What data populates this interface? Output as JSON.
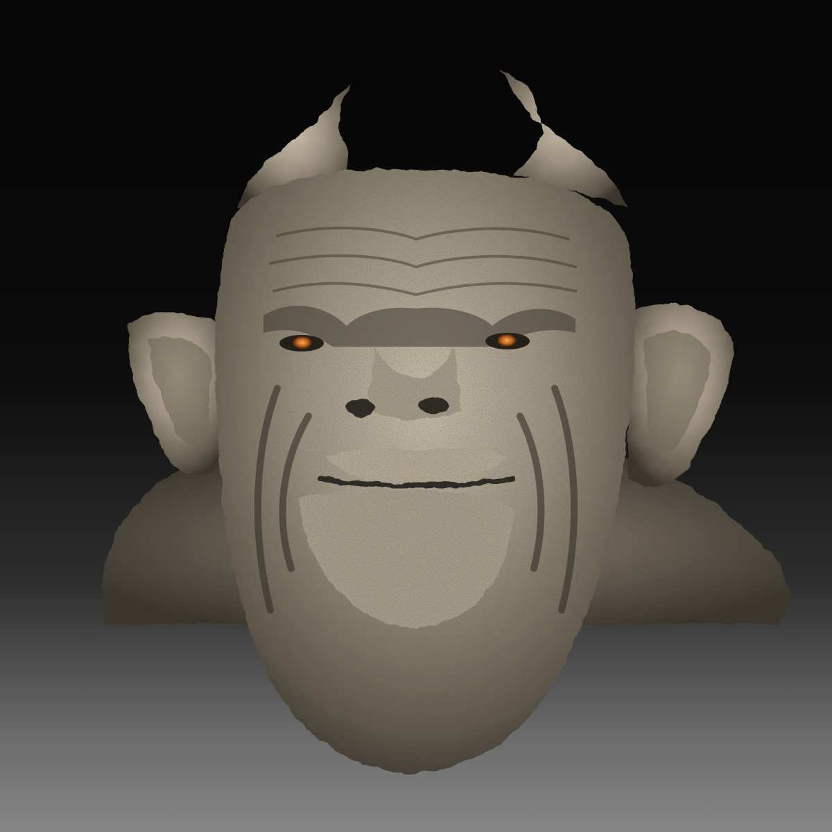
{
  "viewport": {
    "background_top_color": "#050505",
    "background_bottom_color": "#868686"
  },
  "sculpt": {
    "subject": "creature-bust",
    "material_color": "#9c9180",
    "material_shadow_color": "#3a352d",
    "material_highlight_color": "#d3c9b6",
    "eye_color": "#d2681a"
  }
}
